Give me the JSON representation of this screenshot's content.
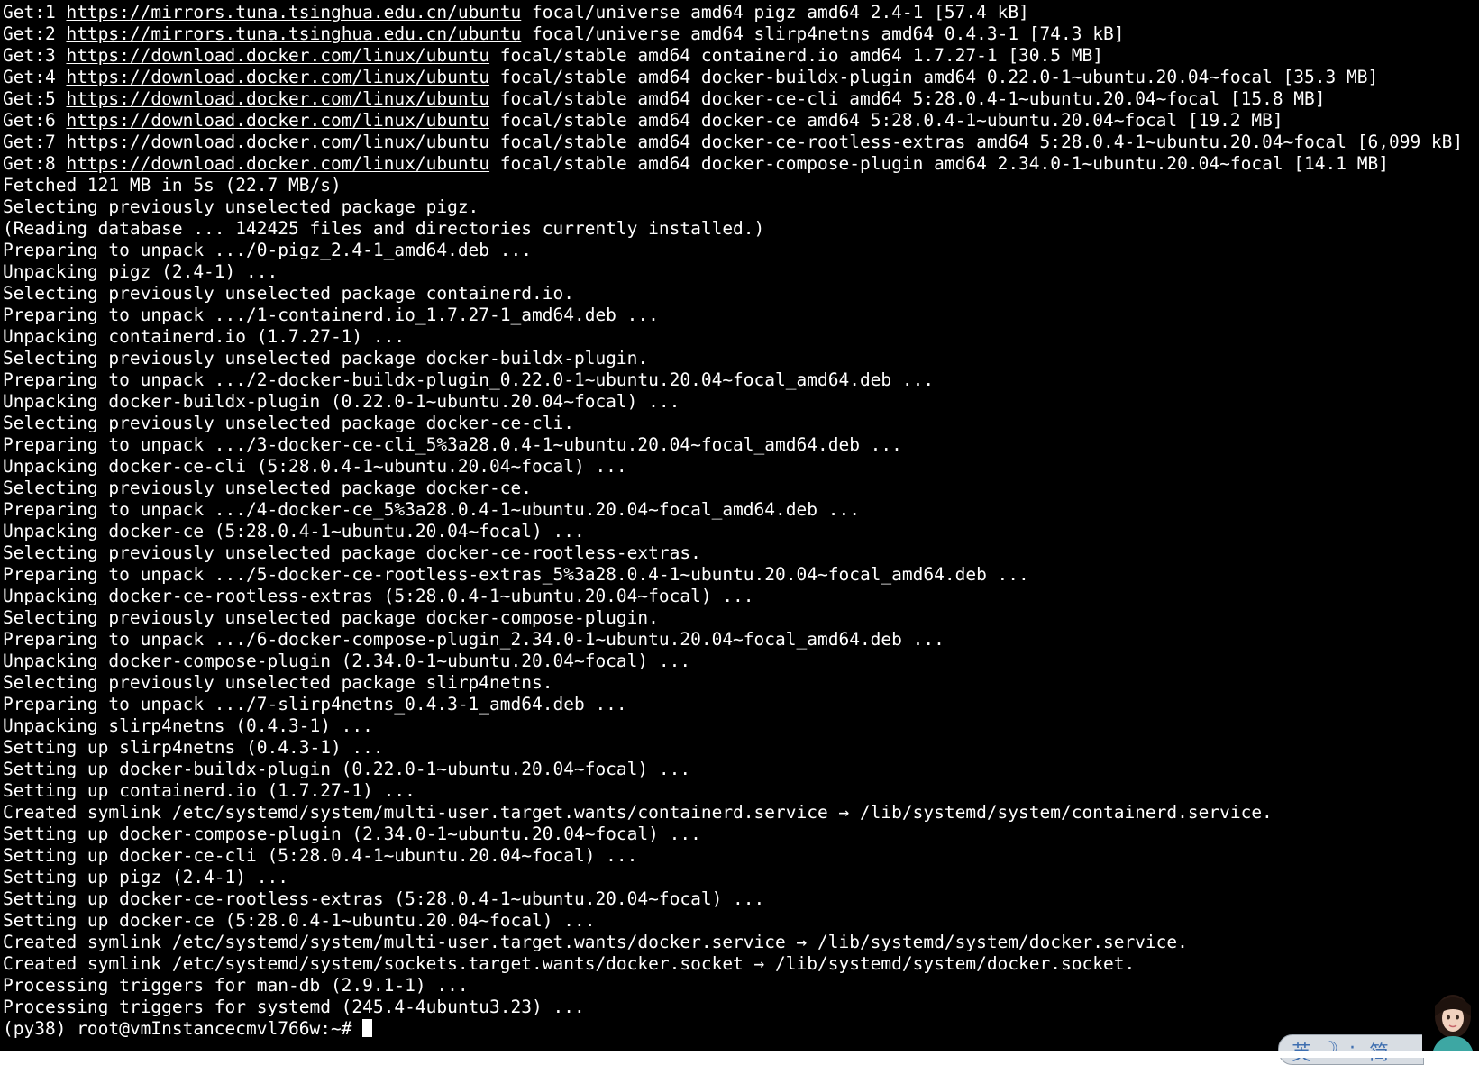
{
  "terminal": {
    "lines": [
      {
        "pre": "Get:1 ",
        "url": "https://mirrors.tuna.tsinghua.edu.cn/ubuntu",
        "post": " focal/universe amd64 pigz amd64 2.4-1 [57.4 kB]"
      },
      {
        "pre": "Get:2 ",
        "url": "https://mirrors.tuna.tsinghua.edu.cn/ubuntu",
        "post": " focal/universe amd64 slirp4netns amd64 0.4.3-1 [74.3 kB]"
      },
      {
        "pre": "Get:3 ",
        "url": "https://download.docker.com/linux/ubuntu",
        "post": " focal/stable amd64 containerd.io amd64 1.7.27-1 [30.5 MB]"
      },
      {
        "pre": "Get:4 ",
        "url": "https://download.docker.com/linux/ubuntu",
        "post": " focal/stable amd64 docker-buildx-plugin amd64 0.22.0-1~ubuntu.20.04~focal [35.3 MB]"
      },
      {
        "pre": "Get:5 ",
        "url": "https://download.docker.com/linux/ubuntu",
        "post": " focal/stable amd64 docker-ce-cli amd64 5:28.0.4-1~ubuntu.20.04~focal [15.8 MB]"
      },
      {
        "pre": "Get:6 ",
        "url": "https://download.docker.com/linux/ubuntu",
        "post": " focal/stable amd64 docker-ce amd64 5:28.0.4-1~ubuntu.20.04~focal [19.2 MB]"
      },
      {
        "pre": "Get:7 ",
        "url": "https://download.docker.com/linux/ubuntu",
        "post": " focal/stable amd64 docker-ce-rootless-extras amd64 5:28.0.4-1~ubuntu.20.04~focal [6,099 kB]"
      },
      {
        "pre": "Get:8 ",
        "url": "https://download.docker.com/linux/ubuntu",
        "post": " focal/stable amd64 docker-compose-plugin amd64 2.34.0-1~ubuntu.20.04~focal [14.1 MB]"
      },
      {
        "text": "Fetched 121 MB in 5s (22.7 MB/s)"
      },
      {
        "text": "Selecting previously unselected package pigz."
      },
      {
        "text": "(Reading database ... 142425 files and directories currently installed.)"
      },
      {
        "text": "Preparing to unpack .../0-pigz_2.4-1_amd64.deb ..."
      },
      {
        "text": "Unpacking pigz (2.4-1) ..."
      },
      {
        "text": "Selecting previously unselected package containerd.io."
      },
      {
        "text": "Preparing to unpack .../1-containerd.io_1.7.27-1_amd64.deb ..."
      },
      {
        "text": "Unpacking containerd.io (1.7.27-1) ..."
      },
      {
        "text": "Selecting previously unselected package docker-buildx-plugin."
      },
      {
        "text": "Preparing to unpack .../2-docker-buildx-plugin_0.22.0-1~ubuntu.20.04~focal_amd64.deb ..."
      },
      {
        "text": "Unpacking docker-buildx-plugin (0.22.0-1~ubuntu.20.04~focal) ..."
      },
      {
        "text": "Selecting previously unselected package docker-ce-cli."
      },
      {
        "text": "Preparing to unpack .../3-docker-ce-cli_5%3a28.0.4-1~ubuntu.20.04~focal_amd64.deb ..."
      },
      {
        "text": "Unpacking docker-ce-cli (5:28.0.4-1~ubuntu.20.04~focal) ..."
      },
      {
        "text": "Selecting previously unselected package docker-ce."
      },
      {
        "text": "Preparing to unpack .../4-docker-ce_5%3a28.0.4-1~ubuntu.20.04~focal_amd64.deb ..."
      },
      {
        "text": "Unpacking docker-ce (5:28.0.4-1~ubuntu.20.04~focal) ..."
      },
      {
        "text": "Selecting previously unselected package docker-ce-rootless-extras."
      },
      {
        "text": "Preparing to unpack .../5-docker-ce-rootless-extras_5%3a28.0.4-1~ubuntu.20.04~focal_amd64.deb ..."
      },
      {
        "text": "Unpacking docker-ce-rootless-extras (5:28.0.4-1~ubuntu.20.04~focal) ..."
      },
      {
        "text": "Selecting previously unselected package docker-compose-plugin."
      },
      {
        "text": "Preparing to unpack .../6-docker-compose-plugin_2.34.0-1~ubuntu.20.04~focal_amd64.deb ..."
      },
      {
        "text": "Unpacking docker-compose-plugin (2.34.0-1~ubuntu.20.04~focal) ..."
      },
      {
        "text": "Selecting previously unselected package slirp4netns."
      },
      {
        "text": "Preparing to unpack .../7-slirp4netns_0.4.3-1_amd64.deb ..."
      },
      {
        "text": "Unpacking slirp4netns (0.4.3-1) ..."
      },
      {
        "text": "Setting up slirp4netns (0.4.3-1) ..."
      },
      {
        "text": "Setting up docker-buildx-plugin (0.22.0-1~ubuntu.20.04~focal) ..."
      },
      {
        "text": "Setting up containerd.io (1.7.27-1) ..."
      },
      {
        "text": "Created symlink /etc/systemd/system/multi-user.target.wants/containerd.service → /lib/systemd/system/containerd.service."
      },
      {
        "text": "Setting up docker-compose-plugin (2.34.0-1~ubuntu.20.04~focal) ..."
      },
      {
        "text": "Setting up docker-ce-cli (5:28.0.4-1~ubuntu.20.04~focal) ..."
      },
      {
        "text": "Setting up pigz (2.4-1) ..."
      },
      {
        "text": "Setting up docker-ce-rootless-extras (5:28.0.4-1~ubuntu.20.04~focal) ..."
      },
      {
        "text": "Setting up docker-ce (5:28.0.4-1~ubuntu.20.04~focal) ..."
      },
      {
        "text": "Created symlink /etc/systemd/system/multi-user.target.wants/docker.service → /lib/systemd/system/docker.service."
      },
      {
        "text": "Created symlink /etc/systemd/system/sockets.target.wants/docker.socket → /lib/systemd/system/docker.socket."
      },
      {
        "text": "Processing triggers for man-db (2.9.1-1) ..."
      },
      {
        "text": "Processing triggers for systemd (245.4-4ubuntu3.23) ..."
      }
    ],
    "prompt": "(py38) root@vmInstancecmvl766w:~# "
  },
  "ime_toolbar": {
    "lang_label": "英",
    "mode_label": "简",
    "icon": "ime-moon-icon"
  },
  "colors": {
    "background": "#000000",
    "foreground": "#ffffff",
    "ime_accent": "#3f6fb0"
  }
}
